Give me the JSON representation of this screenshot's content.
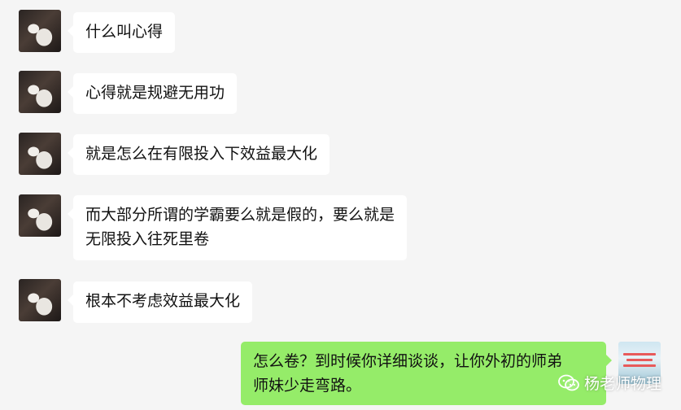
{
  "chat": {
    "messages": [
      {
        "side": "in",
        "text": "什么叫心得"
      },
      {
        "side": "in",
        "text": "心得就是规避无用功"
      },
      {
        "side": "in",
        "text": "就是怎么在有限投入下效益最大化"
      },
      {
        "side": "in",
        "lines": [
          "而大部分所谓的学霸要么就是假的，要么就是",
          "无限投入往死里卷"
        ]
      },
      {
        "side": "in",
        "text": "根本不考虑效益最大化"
      },
      {
        "side": "out",
        "lines": [
          "怎么卷？到时候你详细谈谈，让你外初的师弟",
          "师妹少走弯路。"
        ]
      }
    ]
  },
  "watermark": {
    "icon": "wechat-icon",
    "text": "杨老师物理"
  },
  "colors": {
    "background": "#f5f5f5",
    "incoming_bubble": "#ffffff",
    "outgoing_bubble": "#95ec69"
  }
}
